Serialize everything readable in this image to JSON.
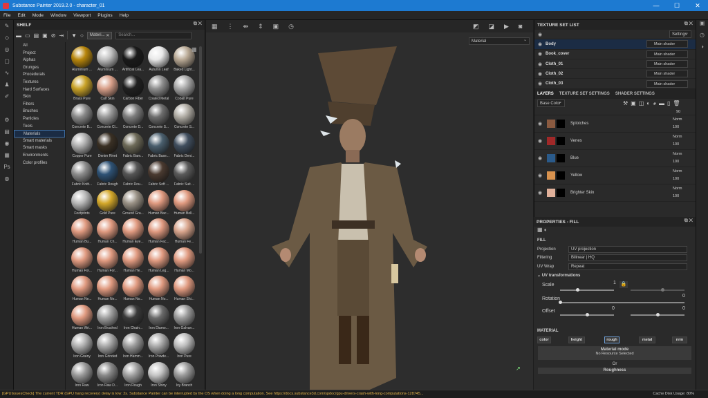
{
  "window": {
    "title": "Substance Painter 2019.2.0 - character_01",
    "minimize": "—",
    "maximize": "☐",
    "close": "✕"
  },
  "menu": [
    "File",
    "Edit",
    "Mode",
    "Window",
    "Viewport",
    "Plugins",
    "Help"
  ],
  "shelf": {
    "title": "SHELF",
    "filter_tag": "Materi...",
    "search_placeholder": "Search...",
    "categories": [
      "All",
      "Project",
      "Alphas",
      "Grunges",
      "Procedurals",
      "Textures",
      "Hard Surfaces",
      "Skin",
      "Filters",
      "Brushes",
      "Particles",
      "Tools",
      "Materials",
      "Smart materials",
      "Smart masks",
      "Environments",
      "Color profiles"
    ],
    "selected_category": "Materials",
    "materials": [
      {
        "name": "Aluminium ...",
        "color": "#b8860b"
      },
      {
        "name": "Aluminium ...",
        "color": "#c0c0c0"
      },
      {
        "name": "Artificial Lea...",
        "color": "#1a1a1a"
      },
      {
        "name": "Autumn Leaf",
        "color": "#e8e8e8"
      },
      {
        "name": "Baked Light...",
        "color": "#b9a995"
      },
      {
        "name": "Brass Pure",
        "color": "#c9a227"
      },
      {
        "name": "Calf Skin",
        "color": "#d9a08a"
      },
      {
        "name": "Carbon Fiber",
        "color": "#202020"
      },
      {
        "name": "Coated Metal",
        "color": "#909090"
      },
      {
        "name": "Cobalt Pure",
        "color": "#a8a8a8"
      },
      {
        "name": "Concrete B...",
        "color": "#8a8a8a"
      },
      {
        "name": "Concrete Cl...",
        "color": "#9a9a9a"
      },
      {
        "name": "Concrete D...",
        "color": "#7d7d7d"
      },
      {
        "name": "Concrete S...",
        "color": "#6e6e6e"
      },
      {
        "name": "Concrete S...",
        "color": "#b0aca4"
      },
      {
        "name": "Copper Pure",
        "color": "#b0b0b0"
      },
      {
        "name": "Denim Rivet",
        "color": "#3a3024"
      },
      {
        "name": "Fabric Bam...",
        "color": "#6d6a58"
      },
      {
        "name": "Fabric Base...",
        "color": "#4a5f6e"
      },
      {
        "name": "Fabric Deni...",
        "color": "#404e5e"
      },
      {
        "name": "Fabric Knitt...",
        "color": "#8d8d8d"
      },
      {
        "name": "Fabric Rough",
        "color": "#2e5275"
      },
      {
        "name": "Fabric Rou...",
        "color": "#555555"
      },
      {
        "name": "Fabric Soft ...",
        "color": "#4a3a30"
      },
      {
        "name": "Fabric Suit ...",
        "color": "#5a5a5a"
      },
      {
        "name": "Footprints",
        "color": "#b8b8b8"
      },
      {
        "name": "Gold Pure",
        "color": "#d4a82a"
      },
      {
        "name": "Ground Gra...",
        "color": "#9a9286"
      },
      {
        "name": "Human Bac...",
        "color": "#e09a80"
      },
      {
        "name": "Human Bell...",
        "color": "#e09a80"
      },
      {
        "name": "Human Bu...",
        "color": "#e09a80"
      },
      {
        "name": "Human Ch...",
        "color": "#e09a80"
      },
      {
        "name": "Human Eye...",
        "color": "#e09a80"
      },
      {
        "name": "Human Fac...",
        "color": "#e09a80"
      },
      {
        "name": "Human Fe...",
        "color": "#d8a48c"
      },
      {
        "name": "Human For...",
        "color": "#e09a80"
      },
      {
        "name": "Human For...",
        "color": "#e09a80"
      },
      {
        "name": "Human He...",
        "color": "#e09a80"
      },
      {
        "name": "Human Leg...",
        "color": "#e09a80"
      },
      {
        "name": "Human Mo...",
        "color": "#e09a80"
      },
      {
        "name": "Human Ne...",
        "color": "#e09a80"
      },
      {
        "name": "Human Ne...",
        "color": "#e09a80"
      },
      {
        "name": "Human No...",
        "color": "#e09a80"
      },
      {
        "name": "Human No...",
        "color": "#e09a80"
      },
      {
        "name": "Human Shi...",
        "color": "#e09a80"
      },
      {
        "name": "Human Wri...",
        "color": "#e09a80"
      },
      {
        "name": "Iron Brushed",
        "color": "#a0a0a0"
      },
      {
        "name": "Iron Chain...",
        "color": "#3a3a3a"
      },
      {
        "name": "Iron Diamo...",
        "color": "#6a6a6a"
      },
      {
        "name": "Iron Galvan...",
        "color": "#9a9a9a"
      },
      {
        "name": "Iron Grainy",
        "color": "#b0b0b0"
      },
      {
        "name": "Iron Grinded",
        "color": "#a8a8a8"
      },
      {
        "name": "Iron Hamm...",
        "color": "#9c9c9c"
      },
      {
        "name": "Iron Powde...",
        "color": "#aaaaaa"
      },
      {
        "name": "Iron Pure",
        "color": "#bcbcbc"
      },
      {
        "name": "Iron Raw",
        "color": "#9a9a9a"
      },
      {
        "name": "Iron Raw D...",
        "color": "#888888"
      },
      {
        "name": "Iron Rough",
        "color": "#a0a0a0"
      },
      {
        "name": "Iron Shiny",
        "color": "#c4c4c4"
      },
      {
        "name": "Ivy Branch",
        "color": "#9a9a9a"
      }
    ]
  },
  "viewport": {
    "mode": "Material"
  },
  "texture_set_list": {
    "title": "TEXTURE SET LIST",
    "settings_label": "Settings",
    "sets": [
      {
        "name": "Body",
        "shader": "Main shader"
      },
      {
        "name": "Book_cover",
        "shader": "Main shader"
      },
      {
        "name": "Cloth_01",
        "shader": "Main shader"
      },
      {
        "name": "Cloth_02",
        "shader": "Main shader"
      },
      {
        "name": "Cloth_03",
        "shader": "Main shader"
      }
    ]
  },
  "layers_tabs": [
    "LAYERS",
    "TEXTURE SET SETTINGS",
    "SHADER SETTINGS"
  ],
  "layers": {
    "channel": "Base Color",
    "top_opacity": "90",
    "items": [
      {
        "name": "Splotches",
        "color": "#8a5a40",
        "blend": "Norm",
        "opacity": "100"
      },
      {
        "name": "Venes",
        "color": "#a02828",
        "blend": "Norm",
        "opacity": "100"
      },
      {
        "name": "Blue",
        "color": "#2a5a8a",
        "blend": "Norm",
        "opacity": "100"
      },
      {
        "name": "Yellow",
        "color": "#d8924e",
        "blend": "Norm",
        "opacity": "100"
      },
      {
        "name": "Brighter Skin",
        "color": "#e0b09a",
        "blend": "Norm",
        "opacity": "100"
      }
    ]
  },
  "properties": {
    "title": "PROPERTIES - FILL",
    "fill_header": "FILL",
    "projection_label": "Projection",
    "projection": "UV projection",
    "filtering_label": "Filtering",
    "filtering": "Bilinear | HQ",
    "uvwrap_label": "UV Wrap",
    "uvwrap": "Repeat",
    "uv_header": "UV transformations",
    "scale_label": "Scale",
    "scale_value": "1",
    "rotation_label": "Rotation",
    "rotation_value": "0",
    "offset_label": "Offset",
    "offset_x": "0",
    "offset_y": "0",
    "scale_level": 0.33,
    "scale_level_2": 0.6,
    "rotation_level": 0.0,
    "offset_x_level": 0.5,
    "offset_y_level": 0.5,
    "material_header": "MATERIAL",
    "channels": [
      "color",
      "height",
      "rough",
      "metal",
      "nrm"
    ],
    "active_channel": "rough",
    "material_mode_label": "Material mode",
    "material_mode_value": "No Resource Selected",
    "or_label": "Or",
    "roughness_label": "Roughness"
  },
  "status": {
    "message": "[GPUIssuesCheck] The current TDR (GPU hang recovery) delay is low: 2s. Substance Painter can be interrupted by the OS when doing a long computation. See https://docs.substance3d.com/spdoc/gpu-drivers-crash-with-long-computations-128745...",
    "cache": "Cache Disk Usage:   80%"
  }
}
